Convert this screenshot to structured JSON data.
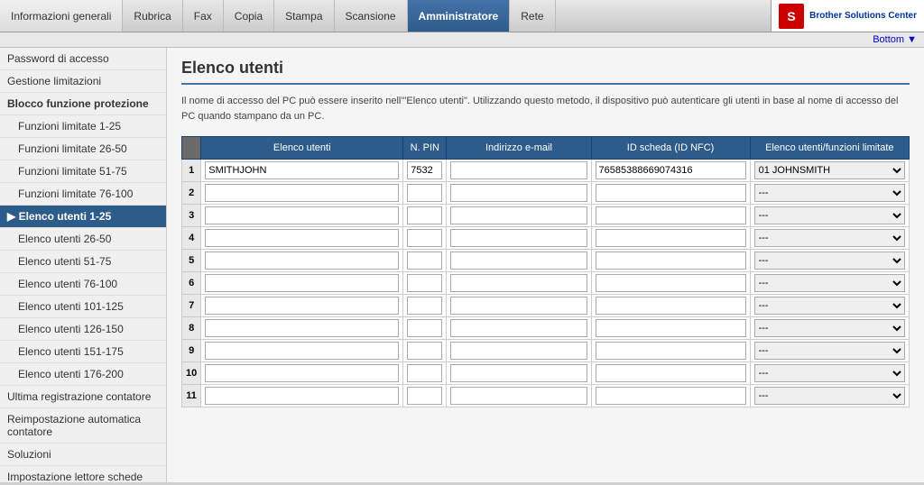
{
  "tabs": [
    {
      "id": "informazioni",
      "label": "Informazioni generali",
      "active": false
    },
    {
      "id": "rubrica",
      "label": "Rubrica",
      "active": false
    },
    {
      "id": "fax",
      "label": "Fax",
      "active": false
    },
    {
      "id": "copia",
      "label": "Copia",
      "active": false
    },
    {
      "id": "stampa",
      "label": "Stampa",
      "active": false
    },
    {
      "id": "scansione",
      "label": "Scansione",
      "active": false
    },
    {
      "id": "amministratore",
      "label": "Amministratore",
      "active": true
    },
    {
      "id": "rete",
      "label": "Rete",
      "active": false
    }
  ],
  "brother": {
    "icon_text": "S",
    "title": "Brother Solutions Center"
  },
  "bottom_nav": {
    "label": "Bottom ▼"
  },
  "sidebar": {
    "items": [
      {
        "id": "password",
        "label": "Password di accesso",
        "indented": false,
        "active": false
      },
      {
        "id": "gestione",
        "label": "Gestione limitazioni",
        "indented": false,
        "active": false
      },
      {
        "id": "blocco",
        "label": "Blocco funzione protezione",
        "indented": false,
        "bold": true,
        "active": false
      },
      {
        "id": "funzioni1",
        "label": "Funzioni limitate  1-25",
        "indented": true,
        "active": false
      },
      {
        "id": "funzioni2",
        "label": "Funzioni limitate  26-50",
        "indented": true,
        "active": false
      },
      {
        "id": "funzioni3",
        "label": "Funzioni limitate  51-75",
        "indented": true,
        "active": false
      },
      {
        "id": "funzioni4",
        "label": "Funzioni limitate  76-100",
        "indented": true,
        "active": false
      },
      {
        "id": "elenco1",
        "label": "▶ Elenco utenti 1-25",
        "indented": false,
        "active": true
      },
      {
        "id": "elenco2",
        "label": "Elenco utenti 26-50",
        "indented": true,
        "active": false
      },
      {
        "id": "elenco3",
        "label": "Elenco utenti 51-75",
        "indented": true,
        "active": false
      },
      {
        "id": "elenco4",
        "label": "Elenco utenti 76-100",
        "indented": true,
        "active": false
      },
      {
        "id": "elenco5",
        "label": "Elenco utenti 101-125",
        "indented": true,
        "active": false
      },
      {
        "id": "elenco6",
        "label": "Elenco utenti 126-150",
        "indented": true,
        "active": false
      },
      {
        "id": "elenco7",
        "label": "Elenco utenti 151-175",
        "indented": true,
        "active": false
      },
      {
        "id": "elenco8",
        "label": "Elenco utenti 176-200",
        "indented": true,
        "active": false
      },
      {
        "id": "ultima",
        "label": "Ultima registrazione contatore",
        "indented": false,
        "active": false
      },
      {
        "id": "reimpostazione",
        "label": "Reimpostazione automatica contatore",
        "indented": false,
        "active": false
      },
      {
        "id": "soluzioni",
        "label": "Soluzioni",
        "indented": false,
        "active": false
      },
      {
        "id": "impostazione",
        "label": "Impostazione lettore schede",
        "indented": false,
        "active": false
      }
    ]
  },
  "page": {
    "title": "Elenco utenti",
    "description": "Il nome di accesso del PC può essere inserito nell'\"Elenco utenti\". Utilizzando questo metodo, il dispositivo può autenticare gli utenti in base al nome di accesso del PC quando stampano da un PC."
  },
  "table": {
    "headers": {
      "row_num": "#",
      "elenco": "Elenco utenti",
      "pin": "N. PIN",
      "email": "Indirizzo e-mail",
      "id_scheda": "ID scheda (ID NFC)",
      "funzioni": "Elenco utenti/funzioni limitate"
    },
    "rows": [
      {
        "num": 1,
        "elenco": "SMITHJOHN",
        "pin": "7532",
        "email": "",
        "id": "76585388669074316",
        "funzioni": "01 JOHNSMITH",
        "has_data": true
      },
      {
        "num": 2,
        "elenco": "",
        "pin": "",
        "email": "",
        "id": "",
        "funzioni": "---",
        "has_data": false
      },
      {
        "num": 3,
        "elenco": "",
        "pin": "",
        "email": "",
        "id": "",
        "funzioni": "---",
        "has_data": false
      },
      {
        "num": 4,
        "elenco": "",
        "pin": "",
        "email": "",
        "id": "",
        "funzioni": "---",
        "has_data": false
      },
      {
        "num": 5,
        "elenco": "",
        "pin": "",
        "email": "",
        "id": "",
        "funzioni": "---",
        "has_data": false
      },
      {
        "num": 6,
        "elenco": "",
        "pin": "",
        "email": "",
        "id": "",
        "funzioni": "---",
        "has_data": false
      },
      {
        "num": 7,
        "elenco": "",
        "pin": "",
        "email": "",
        "id": "",
        "funzioni": "---",
        "has_data": false
      },
      {
        "num": 8,
        "elenco": "",
        "pin": "",
        "email": "",
        "id": "",
        "funzioni": "---",
        "has_data": false
      },
      {
        "num": 9,
        "elenco": "",
        "pin": "",
        "email": "",
        "id": "",
        "funzioni": "---",
        "has_data": false
      },
      {
        "num": 10,
        "elenco": "",
        "pin": "",
        "email": "",
        "id": "",
        "funzioni": "---",
        "has_data": false
      },
      {
        "num": 11,
        "elenco": "",
        "pin": "",
        "email": "",
        "id": "",
        "funzioni": "---",
        "has_data": false
      }
    ]
  }
}
